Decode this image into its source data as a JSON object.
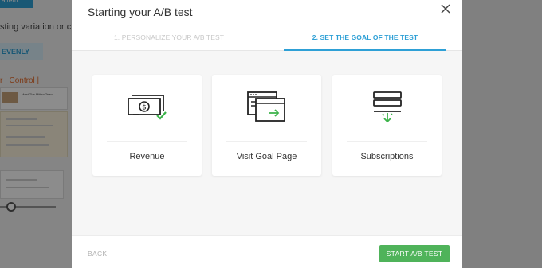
{
  "background": {
    "top_button_label": "atterh",
    "variation_text": "sting variation or create",
    "evenly_label": "EVENLY",
    "control_label": "r | Control |",
    "thumb_caption": "Meet The Mitten Team",
    "accent_color": "#2ea0d6"
  },
  "modal": {
    "title": "Starting your A/B test",
    "close_icon": "close-icon",
    "steps": [
      {
        "label": "1. PERSONALIZE YOUR A/B TEST",
        "active": false
      },
      {
        "label": "2. SET THE GOAL OF THE TEST",
        "active": true
      }
    ],
    "goals": [
      {
        "label": "Revenue",
        "icon": "money-check-icon"
      },
      {
        "label": "Visit Goal Page",
        "icon": "browser-arrow-icon"
      },
      {
        "label": "Subscriptions",
        "icon": "subscriptions-icon"
      }
    ],
    "footer": {
      "back_label": "BACK",
      "start_label": "START A/B TEST"
    },
    "colors": {
      "active_step": "#2ea0d6",
      "start_button": "#4fb35a",
      "icon_accent": "#3cb34a"
    }
  }
}
